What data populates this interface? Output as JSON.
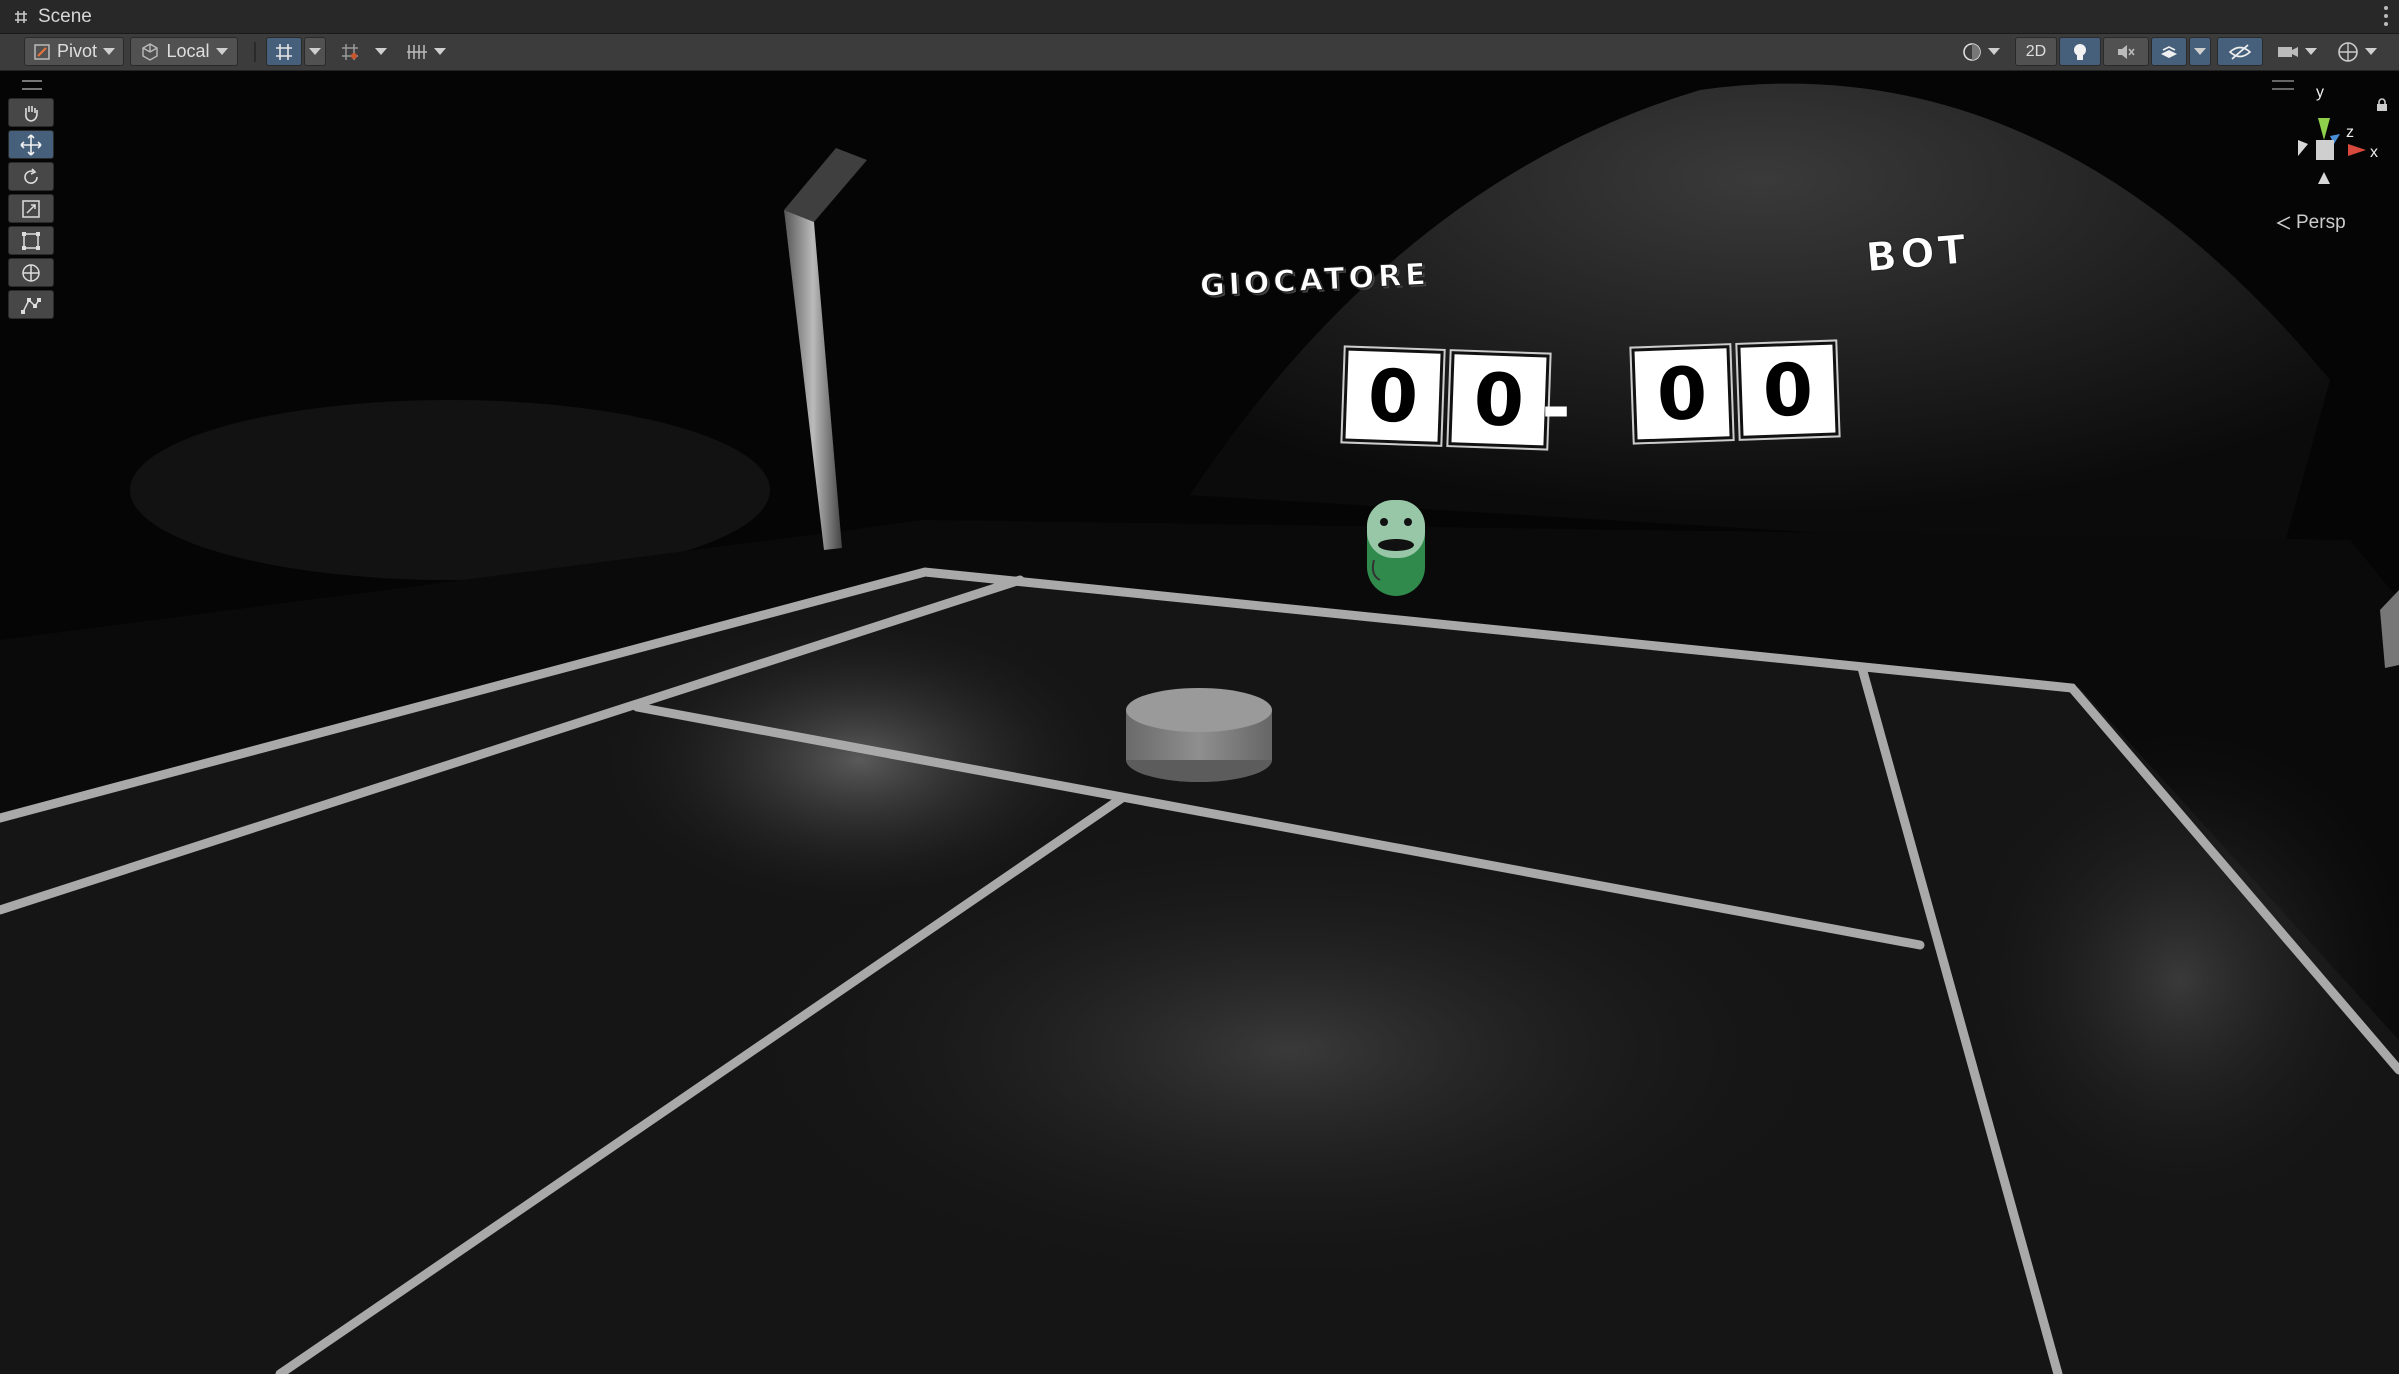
{
  "window": {
    "title": "Scene"
  },
  "toolbar": {
    "pivot_label": "Pivot",
    "local_label": "Local",
    "twod_label": "2D"
  },
  "scene": {
    "player_label": "GIOCATORE",
    "bot_label": "BOT",
    "player_score": [
      "0",
      "0"
    ],
    "bot_score": [
      "0",
      "0"
    ],
    "score_separator": "-"
  },
  "gizmo": {
    "y_label": "y",
    "x_label": "x",
    "z_label": "z",
    "projection_label": "Persp"
  },
  "colors": {
    "active_button": "#46607c",
    "toolbar_bg": "#3c3c3c",
    "x_axis": "#d84a3e",
    "y_axis": "#8fd14a",
    "z_axis": "#4a8ed8",
    "character_green": "#2f8a4c"
  },
  "icons": {
    "tools": [
      "hand-tool-icon",
      "move-tool-icon",
      "rotate-tool-icon",
      "scale-tool-icon",
      "rect-tool-icon",
      "transform-tool-icon",
      "custom-tool-icon"
    ]
  }
}
